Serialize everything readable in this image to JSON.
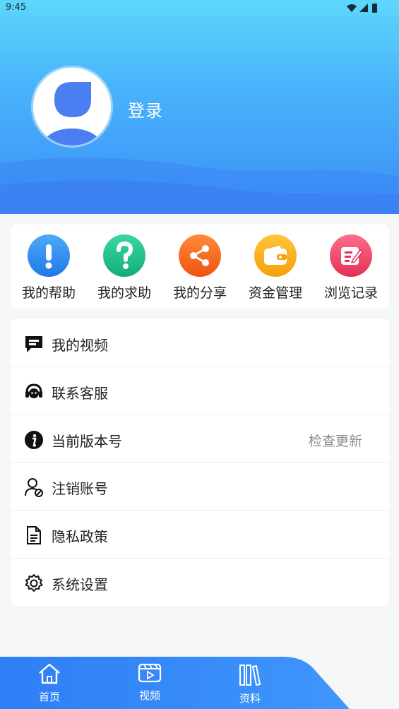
{
  "status_bar": {
    "time": "9:45",
    "icons": [
      "wifi-icon",
      "signal-icon",
      "battery-icon"
    ]
  },
  "profile": {
    "login_label": "登录",
    "avatar_icon": "user-avatar-icon"
  },
  "quick_actions": [
    {
      "label": "我的帮助",
      "icon": "exclamation-icon",
      "color": "#2f8df3"
    },
    {
      "label": "我的求助",
      "icon": "question-icon",
      "color": "#1ec28a"
    },
    {
      "label": "我的分享",
      "icon": "share-icon",
      "color": "#fb6a1d"
    },
    {
      "label": "资金管理",
      "icon": "wallet-icon",
      "color": "#fbb214"
    },
    {
      "label": "浏览记录",
      "icon": "edit-note-icon",
      "color": "#f04a6c"
    }
  ],
  "menu": [
    {
      "label": "我的视频",
      "icon": "message-icon"
    },
    {
      "label": "联系客服",
      "icon": "headset-icon"
    },
    {
      "label": "当前版本号",
      "icon": "info-icon",
      "extra": "检查更新"
    },
    {
      "label": "注销账号",
      "icon": "user-cancel-icon"
    },
    {
      "label": "隐私政策",
      "icon": "document-icon"
    },
    {
      "label": "系统设置",
      "icon": "gear-icon"
    }
  ],
  "bottom_nav": [
    {
      "label": "首页",
      "icon": "home-icon"
    },
    {
      "label": "视频",
      "icon": "video-icon"
    },
    {
      "label": "资料",
      "icon": "books-icon"
    }
  ],
  "colors": {
    "header_top": "#5dd7fb",
    "header_bottom": "#3c8ef7",
    "nav_blue": "#2f7ff7"
  }
}
